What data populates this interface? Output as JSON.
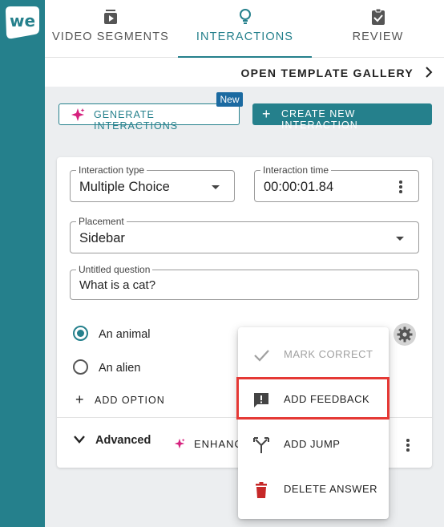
{
  "app": {
    "logo_text": "we",
    "colors": {
      "rail": "#25808c",
      "accent": "#25808c",
      "badge": "#1b6aa1",
      "danger": "#c62828",
      "highlight": "#e53935",
      "sparkle": "#d6217e"
    }
  },
  "tabs": [
    {
      "label": "VIDEO SEGMENTS",
      "icon": "video-segments-icon",
      "active": false
    },
    {
      "label": "INTERACTIONS",
      "icon": "lightbulb-icon",
      "active": true
    },
    {
      "label": "REVIEW",
      "icon": "clipboard-check-icon",
      "active": false
    }
  ],
  "gallery": {
    "label": "OPEN TEMPLATE GALLERY",
    "icon": "chevron-right-icon"
  },
  "actions": {
    "generate_label": "GENERATE INTERACTIONS",
    "generate_badge": "New",
    "create_label": "CREATE NEW INTERACTION"
  },
  "form": {
    "interaction_type": {
      "label": "Interaction type",
      "value": "Multiple Choice"
    },
    "interaction_time": {
      "label": "Interaction time",
      "value": "00:00:01.84"
    },
    "placement": {
      "label": "Placement",
      "value": "Sidebar"
    },
    "question": {
      "label": "Untitled question",
      "value": "What is a cat?"
    },
    "options": [
      {
        "label": "An animal",
        "checked": true
      },
      {
        "label": "An alien",
        "checked": false
      }
    ],
    "add_option_label": "ADD OPTION",
    "advanced_label": "Advanced",
    "enhance_label": "ENHANC"
  },
  "menu": {
    "items": [
      {
        "label": "MARK CORRECT",
        "icon": "check-icon",
        "disabled": true
      },
      {
        "label": "ADD FEEDBACK",
        "icon": "feedback-icon",
        "disabled": false,
        "highlighted": true
      },
      {
        "label": "ADD JUMP",
        "icon": "jump-icon",
        "disabled": false
      },
      {
        "label": "DELETE ANSWER",
        "icon": "trash-icon",
        "disabled": false
      }
    ]
  }
}
